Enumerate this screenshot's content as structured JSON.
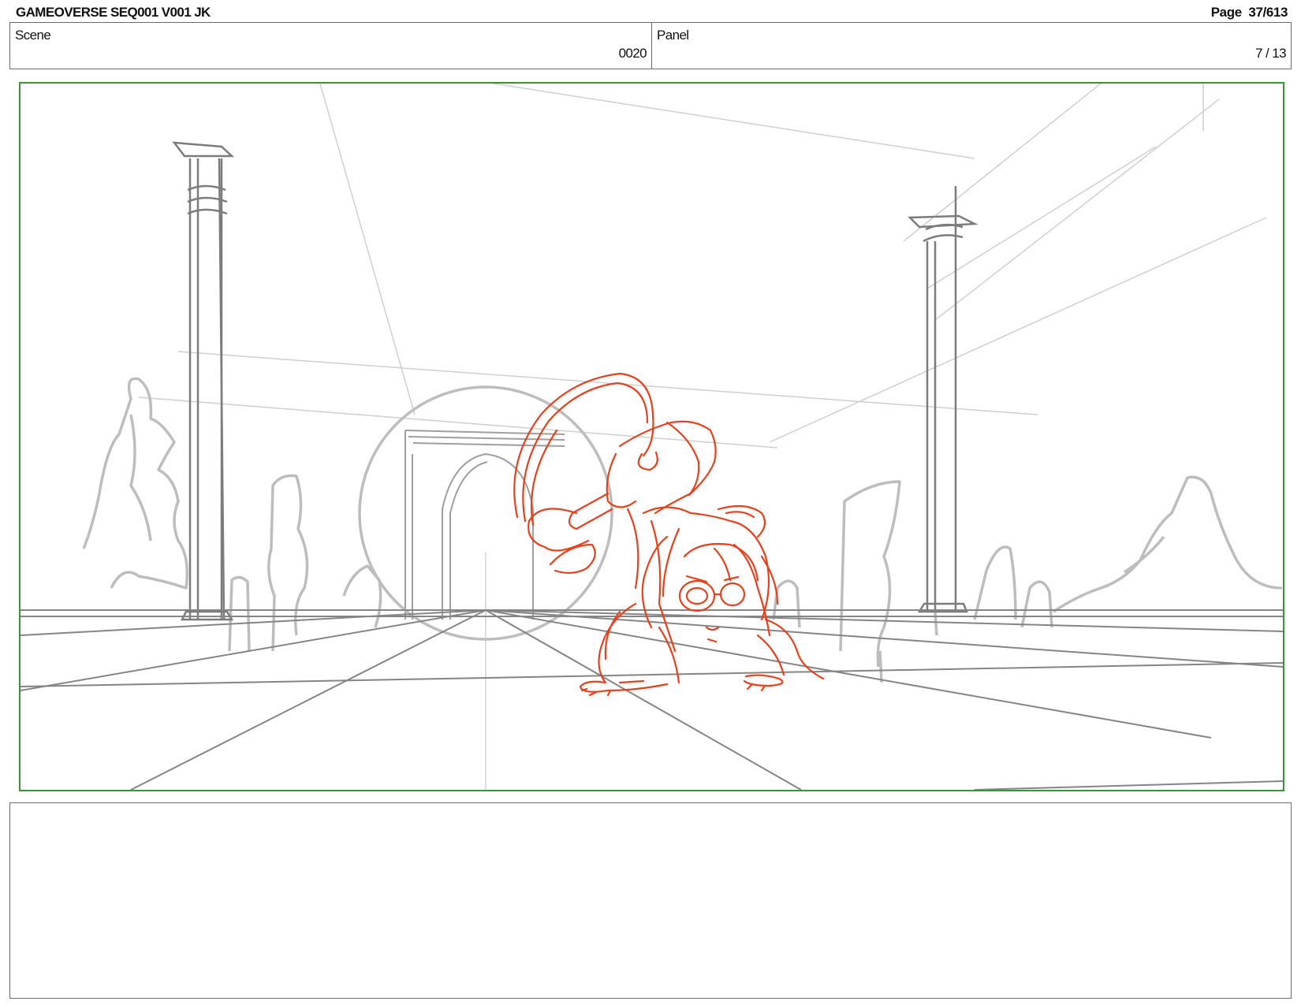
{
  "header": {
    "title": "GAMEOVERSE SEQ001 V001 JK",
    "page": "Page  37/613"
  },
  "info": {
    "scene_label": "Scene",
    "scene_value": "0020",
    "panel_label": "Panel",
    "panel_value": "7 / 13"
  },
  "colors": {
    "frame_border": "#3f8f3f",
    "sketch_character": "#e8401c",
    "sketch_background": "#9a9a9a"
  }
}
